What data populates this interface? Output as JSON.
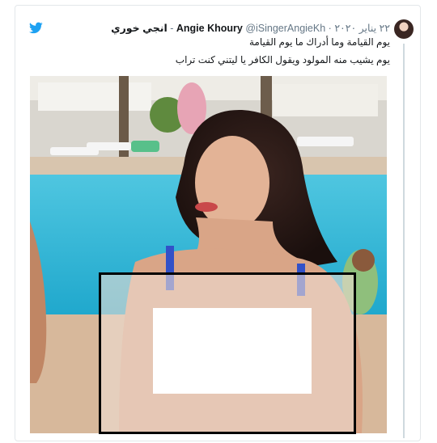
{
  "tweet": {
    "author_name": "Angie Khoury",
    "author_name_ar": "انجي خوري",
    "separator": "-",
    "handle": "@iSingerAngieKh",
    "date_separator": "·",
    "date": "٢٢ يناير ٢٠٢٠",
    "lines": [
      "يوم القيامة وما أدراك ما يوم القيامة",
      "يوم يشيب منه المولود ويقول الكافر يا ليتني كنت تراب"
    ]
  },
  "icons": {
    "brand": "twitter-bird-icon",
    "brand_color": "#1da1f2"
  }
}
